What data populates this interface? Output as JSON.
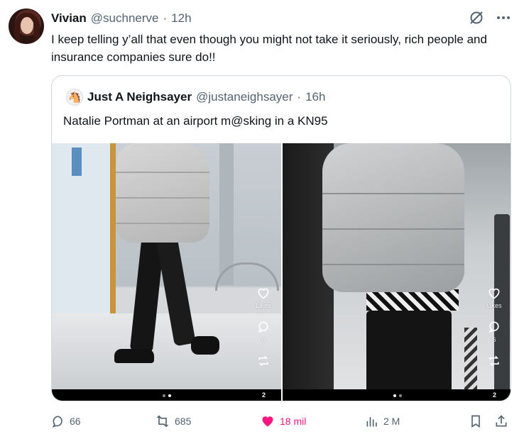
{
  "author": {
    "name": "Vivian",
    "handle": "@suchnerve",
    "separator": "·",
    "time": "12h"
  },
  "tweet_text": "I keep telling y’all that even though you might not take it seriously, rich people and insurance companies sure do!!",
  "quote": {
    "name": "Just A Neighsayer",
    "handle": "@justaneighsayer",
    "separator": "·",
    "time": "16h",
    "text": "Natalie Portman at an airport m@sking in a KN95",
    "media": [
      {
        "likes_label": "Likes",
        "comments_count": "6",
        "page_count": "2"
      },
      {
        "likes_label": "Likes",
        "comments_count": "6",
        "page_count": "2"
      }
    ]
  },
  "actions": {
    "replies": "66",
    "reposts": "685",
    "likes": "18 mil",
    "views": "2 M"
  },
  "colors": {
    "muted": "#536471",
    "like_pink": "#f91880",
    "border": "#cfd9de"
  },
  "icons": [
    "grok-slash-icon",
    "more-icon",
    "reply-icon",
    "repost-icon",
    "heart-icon",
    "views-icon",
    "bookmark-icon",
    "share-icon"
  ]
}
